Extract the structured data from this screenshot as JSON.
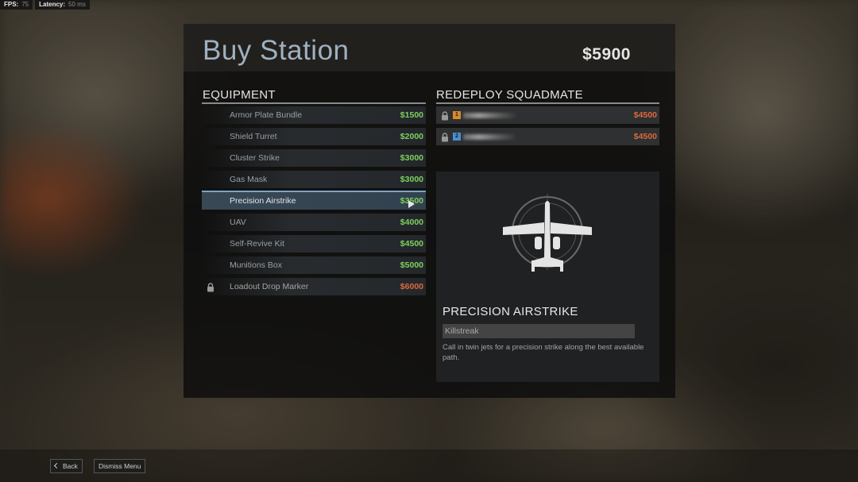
{
  "hud": {
    "fps_label": "FPS:",
    "fps_value": "75",
    "latency_label": "Latency:",
    "latency_value": "50 ms"
  },
  "header": {
    "title": "Buy Station",
    "money": "$5900"
  },
  "equipment": {
    "heading": "EQUIPMENT",
    "items": [
      {
        "name": "Armor Plate Bundle",
        "price": "$1500",
        "state": "available"
      },
      {
        "name": "Shield Turret",
        "price": "$2000",
        "state": "available"
      },
      {
        "name": "Cluster Strike",
        "price": "$3000",
        "state": "available"
      },
      {
        "name": "Gas Mask",
        "price": "$3000",
        "state": "available"
      },
      {
        "name": "Precision Airstrike",
        "price": "$3500",
        "state": "selected"
      },
      {
        "name": "UAV",
        "price": "$4000",
        "state": "available"
      },
      {
        "name": "Self-Revive Kit",
        "price": "$4500",
        "state": "available"
      },
      {
        "name": "Munitions Box",
        "price": "$5000",
        "state": "available"
      },
      {
        "name": "Loadout Drop Marker",
        "price": "$6000",
        "state": "locked"
      }
    ]
  },
  "redeploy": {
    "heading": "REDEPLOY SQUADMATE",
    "squadmates": [
      {
        "badge": "1",
        "badge_color": "#d98a2b",
        "price": "$4500"
      },
      {
        "badge": "2",
        "badge_color": "#4a8fd0",
        "price": "$4500"
      }
    ]
  },
  "detail": {
    "name": "PRECISION AIRSTRIKE",
    "category": "Killstreak",
    "description": "Call in twin jets for a precision strike along the best available path."
  },
  "footer": {
    "back_label": "Back",
    "dismiss_label": "Dismiss Menu"
  },
  "colors": {
    "affordable": "#7fd05e",
    "unaffordable": "#e0683c",
    "title": "#9fb0c0"
  }
}
